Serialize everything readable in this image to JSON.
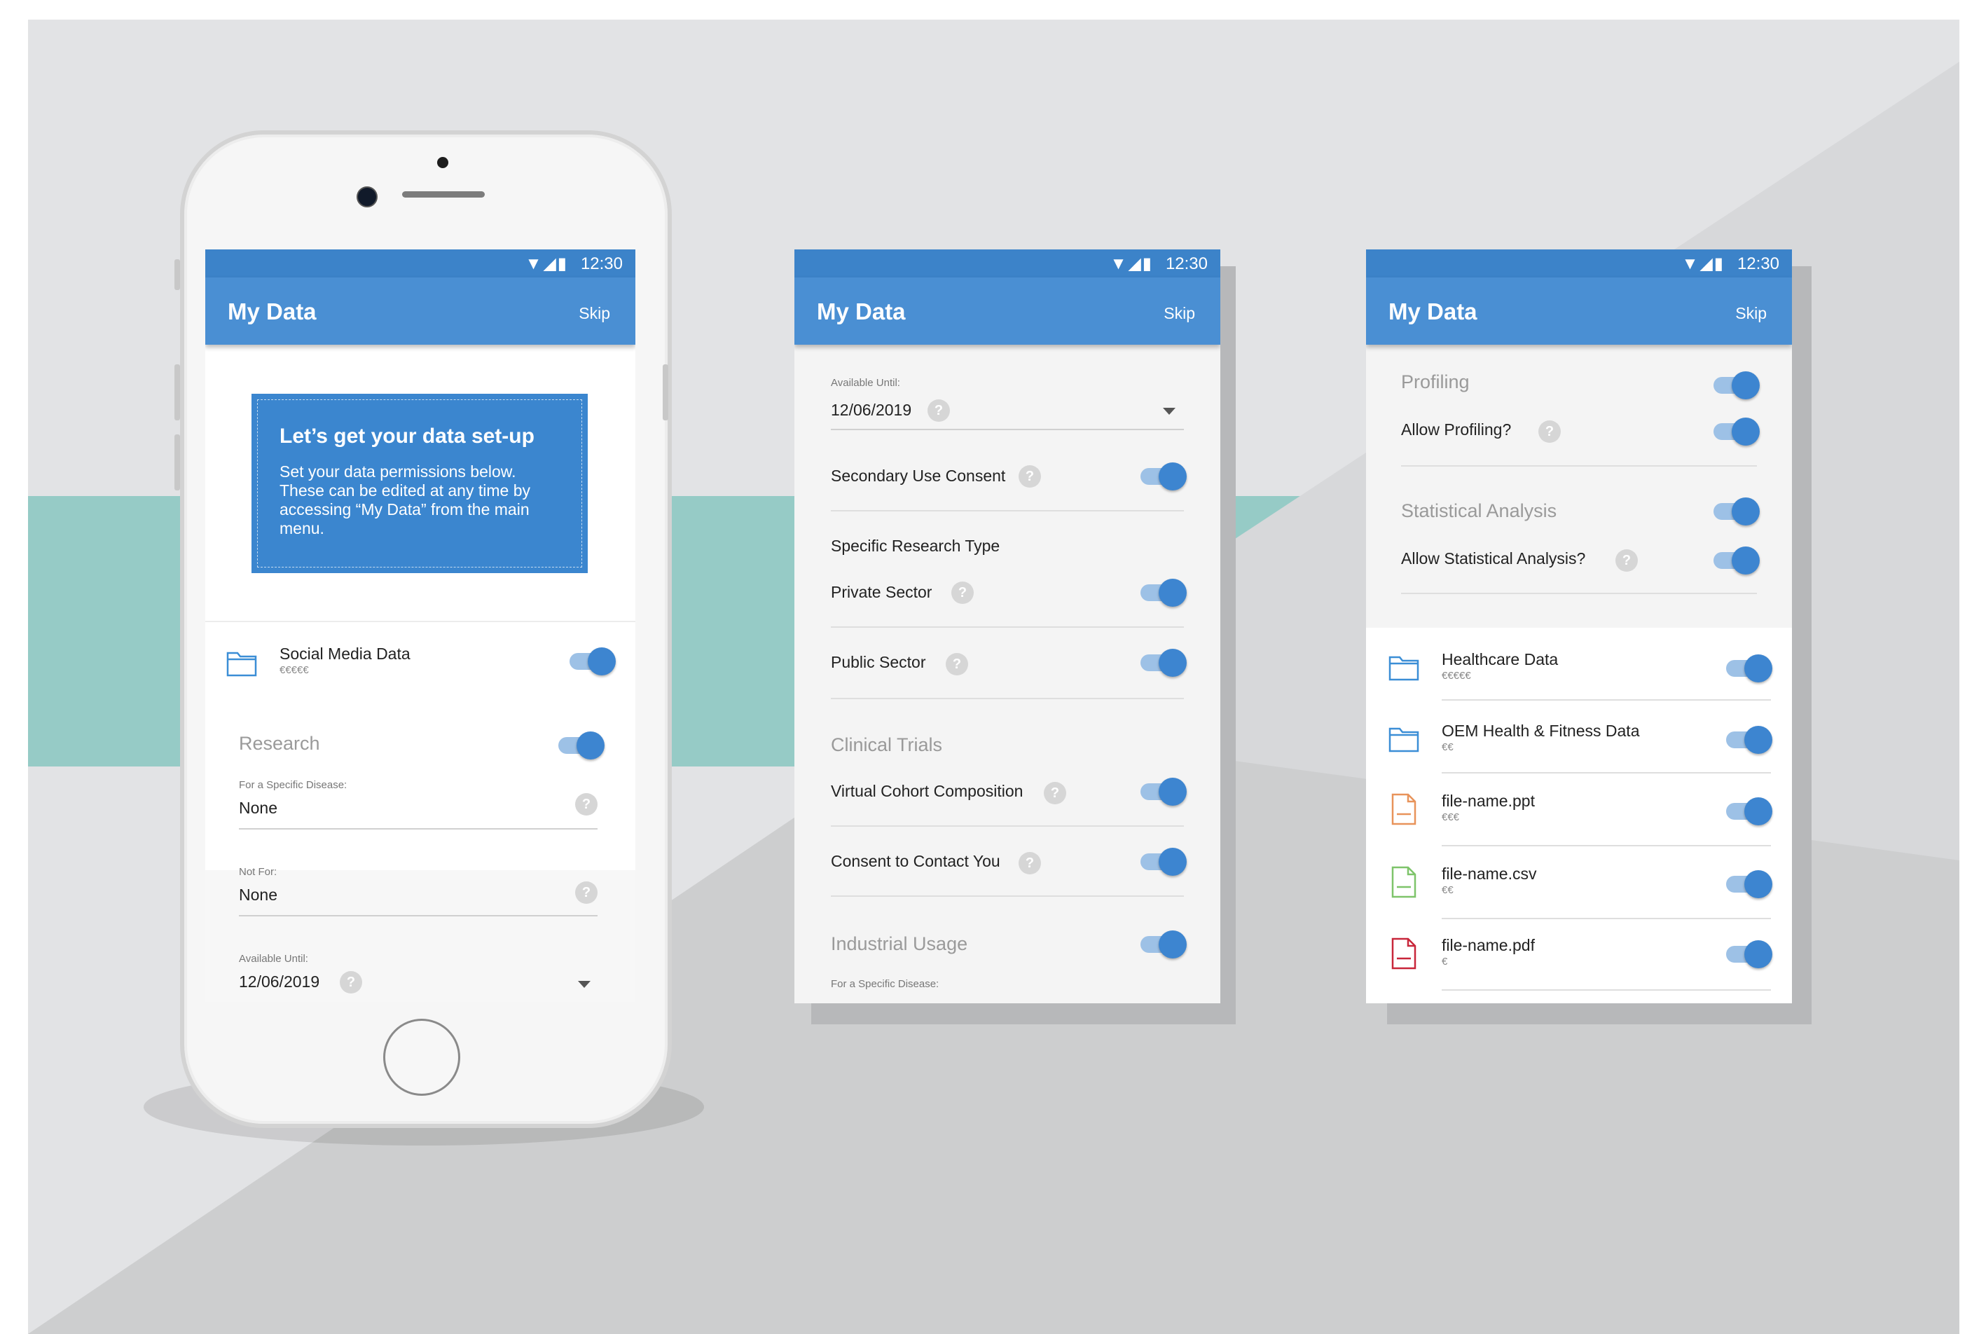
{
  "status": {
    "time": "12:30",
    "icons": "signal-wifi-battery"
  },
  "app": {
    "title": "My Data",
    "skip": "Skip"
  },
  "screen1": {
    "intro_title": "Let’s get your data set-up",
    "intro_text": "Set your data permissions below. These can be edited at any time by accessing “My Data” from the main menu.",
    "social": {
      "label": "Social Media Data",
      "sub": "€€€€€"
    },
    "research": "Research",
    "for_disease_label": "For a Specific Disease:",
    "for_disease_value": "None",
    "not_for_label": "Not For:",
    "not_for_value": "None",
    "available_label": "Available Until:",
    "available_value": "12/06/2019"
  },
  "screen2": {
    "available_label": "Available Until:",
    "available_value": "12/06/2019",
    "secondary": "Secondary Use Consent",
    "specific_research": "Specific Research Type",
    "private": "Private Sector",
    "public": "Public Sector",
    "clinical": "Clinical Trials",
    "virtual": "Virtual Cohort Composition",
    "contact": "Consent to Contact You",
    "industrial": "Industrial Usage",
    "for_disease_label": "For a Specific Disease:"
  },
  "screen3": {
    "profiling": "Profiling",
    "allow_profiling": "Allow Profiling?",
    "statistical": "Statistical Analysis",
    "allow_statistical": "Allow Statistical Analysis?",
    "files": [
      {
        "label": "Healthcare Data",
        "sub": "€€€€€",
        "icon": "folder-icon"
      },
      {
        "label": "OEM Health & Fitness Data",
        "sub": "€€",
        "icon": "folder-icon"
      },
      {
        "label": "file-name.ppt",
        "sub": "€€€",
        "icon": "ppt-file-icon"
      },
      {
        "label": "file-name.csv",
        "sub": "€€",
        "icon": "csv-file-icon"
      },
      {
        "label": "file-name.pdf",
        "sub": "€",
        "icon": "pdf-file-icon"
      }
    ]
  },
  "colors": {
    "accent": "#4a8fd3",
    "statusbar": "#3c83c9",
    "toggle": "#3d85d0",
    "teal_band": "#96cbc6",
    "ppt": "#e8935a",
    "csv": "#7ec46a",
    "pdf": "#c8263a"
  }
}
